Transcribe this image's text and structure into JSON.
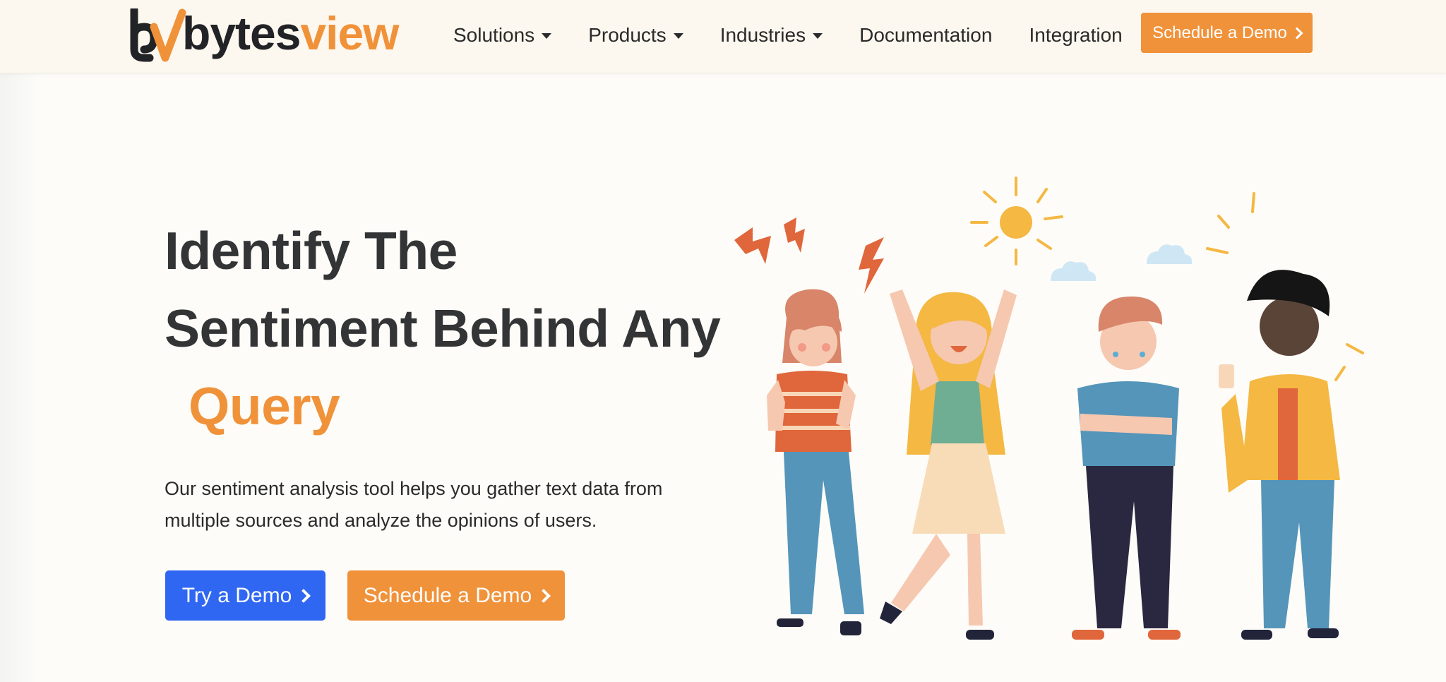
{
  "brand": {
    "name_part1": "bytes",
    "name_part2": "view",
    "accent_color": "#f0923a",
    "dark_color": "#222326"
  },
  "nav": {
    "items": [
      {
        "label": "Solutions",
        "has_dropdown": true
      },
      {
        "label": "Products",
        "has_dropdown": true
      },
      {
        "label": "Industries",
        "has_dropdown": true
      },
      {
        "label": "Documentation",
        "has_dropdown": false
      },
      {
        "label": "Integration",
        "has_dropdown": false
      }
    ],
    "cta_label": "Schedule a Demo"
  },
  "hero": {
    "title_line1": "Identify The",
    "title_line2": "Sentiment Behind Any",
    "title_accent": "Query",
    "subtitle": "Our sentiment analysis tool helps you gather text data from multiple sources and analyze the opinions of users.",
    "primary_button": "Try a Demo",
    "secondary_button": "Schedule a Demo",
    "primary_color": "#2f67f2",
    "secondary_color": "#f0923a"
  },
  "illustration": {
    "icons": [
      "sun-icon",
      "cloud-icon",
      "lightning-icon",
      "worried-person",
      "angry-person",
      "happy-person",
      "sad-person"
    ]
  }
}
